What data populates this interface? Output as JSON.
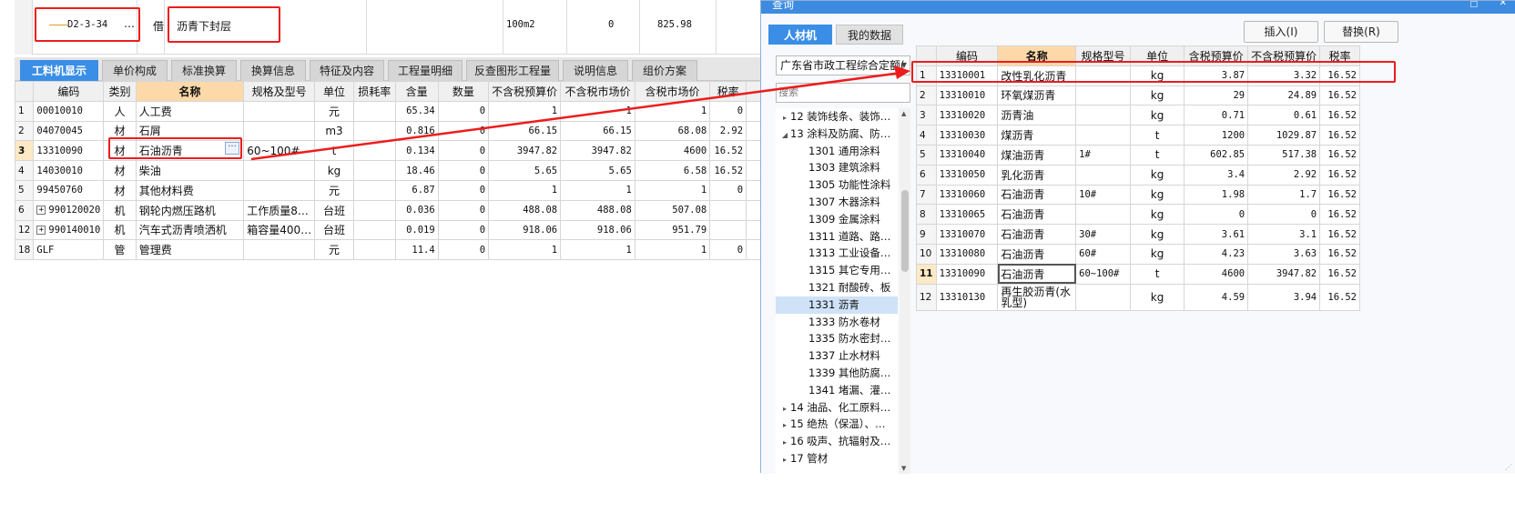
{
  "top_row": {
    "code": "D2-3-34",
    "ellipsis": "…",
    "type": "借",
    "name": "沥青下封层",
    "unit": "100m2",
    "qty": "0",
    "price": "825.98"
  },
  "tabs": [
    {
      "label": "工料机显示",
      "active": true
    },
    {
      "label": "单价构成",
      "active": false
    },
    {
      "label": "标准换算",
      "active": false
    },
    {
      "label": "换算信息",
      "active": false
    },
    {
      "label": "特征及内容",
      "active": false
    },
    {
      "label": "工程量明细",
      "active": false
    },
    {
      "label": "反查图形工程量",
      "active": false
    },
    {
      "label": "说明信息",
      "active": false
    },
    {
      "label": "组价方案",
      "active": false
    }
  ],
  "left_grid": {
    "headers": [
      "",
      "编码",
      "类别",
      "名称",
      "规格及型号",
      "单位",
      "损耗率",
      "含量",
      "数量",
      "不含税预算价",
      "不含税市场价",
      "含税市场价",
      "税率"
    ],
    "rows": [
      {
        "rn": "1",
        "code": "00010010",
        "cat": "人",
        "name": "人工费",
        "spec": "",
        "unit": "元",
        "loss": "",
        "content": "65.34",
        "qty": "0",
        "budget": "1",
        "market": "1",
        "taxmarket": "1",
        "tax": "0"
      },
      {
        "rn": "2",
        "code": "04070045",
        "cat": "材",
        "name": "石屑",
        "spec": "",
        "unit": "m3",
        "loss": "",
        "content": "0.816",
        "qty": "0",
        "budget": "66.15",
        "market": "66.15",
        "taxmarket": "68.08",
        "tax": "2.92"
      },
      {
        "rn": "3",
        "code": "13310090",
        "cat": "材",
        "name": "石油沥青",
        "spec": "60~100#",
        "unit": "t",
        "loss": "",
        "content": "0.134",
        "qty": "0",
        "budget": "3947.82",
        "market": "3947.82",
        "taxmarket": "4600",
        "tax": "16.52"
      },
      {
        "rn": "4",
        "code": "14030010",
        "cat": "材",
        "name": "柴油",
        "spec": "",
        "unit": "kg",
        "loss": "",
        "content": "18.46",
        "qty": "0",
        "budget": "5.65",
        "market": "5.65",
        "taxmarket": "6.58",
        "tax": "16.52"
      },
      {
        "rn": "5",
        "code": "99450760",
        "cat": "材",
        "name": "其他材料费",
        "spec": "",
        "unit": "元",
        "loss": "",
        "content": "6.87",
        "qty": "0",
        "budget": "1",
        "market": "1",
        "taxmarket": "1",
        "tax": "0"
      },
      {
        "rn": "6",
        "code": "990120020",
        "cat": "机",
        "name": "钢轮内燃压路机",
        "spec": "工作质量8…",
        "unit": "台班",
        "loss": "",
        "content": "0.036",
        "qty": "0",
        "budget": "488.08",
        "market": "488.08",
        "taxmarket": "507.08",
        "tax": "",
        "expand": "+"
      },
      {
        "rn": "12",
        "code": "990140010",
        "cat": "机",
        "name": "汽车式沥青喷洒机",
        "spec": "箱容量400…",
        "unit": "台班",
        "loss": "",
        "content": "0.019",
        "qty": "0",
        "budget": "918.06",
        "market": "918.06",
        "taxmarket": "951.79",
        "tax": "",
        "expand": "+"
      },
      {
        "rn": "18",
        "code": "GLF",
        "cat": "管",
        "name": "管理费",
        "spec": "",
        "unit": "元",
        "loss": "",
        "content": "11.4",
        "qty": "0",
        "budget": "1",
        "market": "1",
        "taxmarket": "1",
        "tax": "0"
      }
    ]
  },
  "dialog": {
    "title": "查询",
    "tab_active": "人材机",
    "tab_inactive": "我的数据",
    "insert_btn": "插入(I)",
    "replace_btn": "替换(R)",
    "quota_select": "广东省市政工程综合定额(",
    "search_placeholder": "搜索",
    "tree": [
      {
        "label": "12 装饰线条、装饰…",
        "level": 0,
        "arrow": "▸"
      },
      {
        "label": "13 涂料及防腐、防…",
        "level": 0,
        "arrow": "◢"
      },
      {
        "label": "1301 通用涂料",
        "level": 1
      },
      {
        "label": "1303 建筑涂料",
        "level": 1
      },
      {
        "label": "1305 功能性涂料",
        "level": 1
      },
      {
        "label": "1307 木器涂料",
        "level": 1
      },
      {
        "label": "1309 金属涂料",
        "level": 1
      },
      {
        "label": "1311 道路、路…",
        "level": 1
      },
      {
        "label": "1313 工业设备…",
        "level": 1
      },
      {
        "label": "1315 其它专用…",
        "level": 1
      },
      {
        "label": "1321 耐酸砖、板",
        "level": 1
      },
      {
        "label": "1331 沥青",
        "level": 1,
        "selected": true
      },
      {
        "label": "1333 防水卷材",
        "level": 1
      },
      {
        "label": "1335 防水密封…",
        "level": 1
      },
      {
        "label": "1337 止水材料",
        "level": 1
      },
      {
        "label": "1339 其他防腐…",
        "level": 1
      },
      {
        "label": "1341 堵漏、灌…",
        "level": 1
      },
      {
        "label": "14 油品、化工原料…",
        "level": 0,
        "arrow": "▸"
      },
      {
        "label": "15 绝热（保温）、…",
        "level": 0,
        "arrow": "▸"
      },
      {
        "label": "16 吸声、抗辐射及…",
        "level": 0,
        "arrow": "▸"
      },
      {
        "label": "17 管材",
        "level": 0,
        "arrow": "▸"
      }
    ],
    "grid": {
      "headers": [
        "",
        "编码",
        "名称",
        "规格型号",
        "单位",
        "含税预算价",
        "不含税预算价",
        "税率"
      ],
      "rows": [
        {
          "rn": "1",
          "code": "13310001",
          "name": "改性乳化沥青",
          "spec": "",
          "unit": "kg",
          "taxprice": "3.87",
          "price": "3.32",
          "tax": "16.52"
        },
        {
          "rn": "2",
          "code": "13310010",
          "name": "环氧煤沥青",
          "spec": "",
          "unit": "kg",
          "taxprice": "29",
          "price": "24.89",
          "tax": "16.52"
        },
        {
          "rn": "3",
          "code": "13310020",
          "name": "沥青油",
          "spec": "",
          "unit": "kg",
          "taxprice": "0.71",
          "price": "0.61",
          "tax": "16.52"
        },
        {
          "rn": "4",
          "code": "13310030",
          "name": "煤沥青",
          "spec": "",
          "unit": "t",
          "taxprice": "1200",
          "price": "1029.87",
          "tax": "16.52"
        },
        {
          "rn": "5",
          "code": "13310040",
          "name": "煤油沥青",
          "spec": "1#",
          "unit": "t",
          "taxprice": "602.85",
          "price": "517.38",
          "tax": "16.52"
        },
        {
          "rn": "6",
          "code": "13310050",
          "name": "乳化沥青",
          "spec": "",
          "unit": "kg",
          "taxprice": "3.4",
          "price": "2.92",
          "tax": "16.52"
        },
        {
          "rn": "7",
          "code": "13310060",
          "name": "石油沥青",
          "spec": "10#",
          "unit": "kg",
          "taxprice": "1.98",
          "price": "1.7",
          "tax": "16.52"
        },
        {
          "rn": "8",
          "code": "13310065",
          "name": "石油沥青",
          "spec": "",
          "unit": "kg",
          "taxprice": "0",
          "price": "0",
          "tax": "16.52"
        },
        {
          "rn": "9",
          "code": "13310070",
          "name": "石油沥青",
          "spec": "30#",
          "unit": "kg",
          "taxprice": "3.61",
          "price": "3.1",
          "tax": "16.52"
        },
        {
          "rn": "10",
          "code": "13310080",
          "name": "石油沥青",
          "spec": "60#",
          "unit": "kg",
          "taxprice": "4.23",
          "price": "3.63",
          "tax": "16.52"
        },
        {
          "rn": "11",
          "code": "13310090",
          "name": "石油沥青",
          "spec": "60~100#",
          "unit": "t",
          "taxprice": "4600",
          "price": "3947.82",
          "tax": "16.52"
        },
        {
          "rn": "12",
          "code": "13310130",
          "name": "再生胶沥青(水乳型)",
          "spec": "",
          "unit": "kg",
          "taxprice": "4.59",
          "price": "3.94",
          "tax": "16.52"
        }
      ]
    }
  },
  "colors": {
    "accent_blue": "#3a8ee6",
    "highlight_red": "#ee1c1c",
    "header_orange": "#fdd9a9",
    "row_selected": "#fde9c5"
  }
}
